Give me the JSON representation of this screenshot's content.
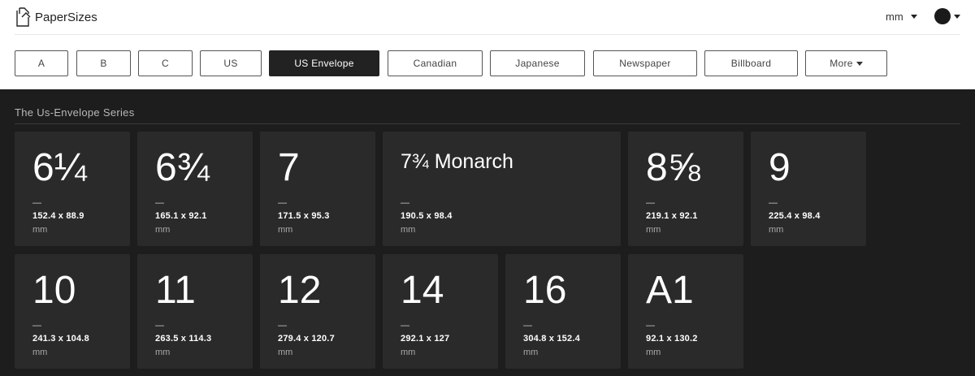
{
  "brand": {
    "name": "PaperSizes",
    "icon": "document-icon"
  },
  "header": {
    "unit": "mm",
    "theme_icon": "theme-circle-icon"
  },
  "tabs": [
    {
      "label": "A",
      "active": false
    },
    {
      "label": "B",
      "active": false
    },
    {
      "label": "C",
      "active": false
    },
    {
      "label": "US",
      "active": false
    },
    {
      "label": "US Envelope",
      "active": true
    },
    {
      "label": "Canadian",
      "active": false
    },
    {
      "label": "Japanese",
      "active": false
    },
    {
      "label": "Newspaper",
      "active": false
    },
    {
      "label": "Billboard",
      "active": false
    },
    {
      "label": "More",
      "active": false
    }
  ],
  "section": {
    "title": "The Us-Envelope Series"
  },
  "sizes": [
    {
      "name": "6¼",
      "dash": "—",
      "dims": "152.4 x 88.9",
      "unit": "mm"
    },
    {
      "name": "6¾",
      "dash": "—",
      "dims": "165.1 x 92.1",
      "unit": "mm"
    },
    {
      "name": "7",
      "dash": "—",
      "dims": "171.5 x 95.3",
      "unit": "mm"
    },
    {
      "name": "7¾ Monarch",
      "dash": "—",
      "dims": "190.5 x 98.4",
      "unit": "mm"
    },
    {
      "name": "8⅝",
      "dash": "—",
      "dims": "219.1 x 92.1",
      "unit": "mm"
    },
    {
      "name": "9",
      "dash": "—",
      "dims": "225.4 x 98.4",
      "unit": "mm"
    },
    {
      "name": "10",
      "dash": "—",
      "dims": "241.3 x 104.8",
      "unit": "mm"
    },
    {
      "name": "11",
      "dash": "—",
      "dims": "263.5 x 114.3",
      "unit": "mm"
    },
    {
      "name": "12",
      "dash": "—",
      "dims": "279.4 x 120.7",
      "unit": "mm"
    },
    {
      "name": "14",
      "dash": "—",
      "dims": "292.1 x 127",
      "unit": "mm"
    },
    {
      "name": "16",
      "dash": "—",
      "dims": "304.8 x 152.4",
      "unit": "mm"
    },
    {
      "name": "A1",
      "dash": "—",
      "dims": "92.1 x 130.2",
      "unit": "mm"
    }
  ],
  "colors": {
    "header_bg": "#ffffff",
    "main_bg": "#1d1d1d",
    "card_bg": "#2a2a2a",
    "active_tab_bg": "#222222"
  }
}
